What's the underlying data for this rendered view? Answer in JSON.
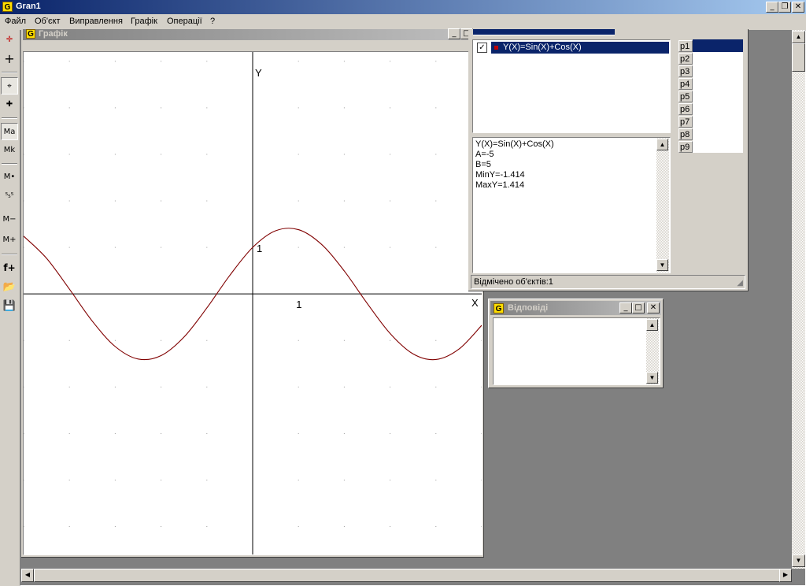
{
  "app": {
    "title": "Gran1",
    "icon": "G"
  },
  "menu": [
    "Файл",
    "Об'єкт",
    "Виправлення",
    "Графік",
    "Операції",
    "?"
  ],
  "toolbar": [
    {
      "name": "axes-icon",
      "glyph": "✛"
    },
    {
      "name": "crosshair-icon",
      "glyph": "+"
    },
    {
      "name": "point-icon",
      "glyph": "⌖"
    },
    {
      "name": "cross-icon",
      "glyph": "✚"
    },
    {
      "name": "zoom-auto-button",
      "glyph": "Ma"
    },
    {
      "name": "zoom-custom-button",
      "glyph": "Mk"
    },
    {
      "name": "zoom-point-button",
      "glyph": "M•"
    },
    {
      "name": "scale-button",
      "glyph": "⁵₅⁵"
    },
    {
      "name": "zoom-out-button",
      "glyph": "M−"
    },
    {
      "name": "zoom-in-button",
      "glyph": "M+"
    },
    {
      "name": "add-function-button",
      "glyph": "f+"
    },
    {
      "name": "open-folder-icon",
      "glyph": "📂"
    },
    {
      "name": "save-disk-icon",
      "glyph": "💾"
    }
  ],
  "graph_window": {
    "title": "Графік",
    "x_axis_label": "X",
    "y_axis_label": "Y",
    "x_tick_label": "1",
    "y_tick_label": "1"
  },
  "chart_data": {
    "type": "line",
    "title": "",
    "xlabel": "X",
    "ylabel": "Y",
    "xlim": [
      -5,
      5
    ],
    "ylim": [
      -5.6,
      5.2
    ],
    "grid": "dots",
    "series": [
      {
        "name": "Y(X)=Sin(X)+Cos(X)",
        "color": "#800000",
        "x": [
          -5,
          -4.5,
          -4,
          -3.5,
          -3,
          -2.5,
          -2,
          -1.5,
          -1,
          -0.5,
          0,
          0.5,
          1,
          1.5,
          2,
          2.5,
          3,
          3.5,
          4,
          4.5,
          5
        ],
        "y": [
          1.242,
          0.767,
          0.103,
          -0.586,
          -1.131,
          -1.399,
          -1.325,
          -0.927,
          -0.301,
          0.398,
          1.0,
          1.357,
          1.382,
          1.068,
          0.493,
          -0.203,
          -0.849,
          -1.287,
          -1.41,
          -1.188,
          -0.675
        ]
      }
    ]
  },
  "objects_panel": {
    "function_item": "Y(X)=Sin(X)+Cos(X)",
    "function_checked": true,
    "info_lines": [
      "Y(X)=Sin(X)+Cos(X)",
      "A=-5",
      "B=5",
      "MinY=-1.414",
      "MaxY=1.414"
    ],
    "status": "Відмічено об'єктів:1",
    "params": [
      "p1",
      "p2",
      "p3",
      "p4",
      "p5",
      "p6",
      "p7",
      "p8",
      "p9"
    ]
  },
  "answers_window": {
    "title": "Відповіді"
  },
  "colors": {
    "title_bar": "#0a246a",
    "title_bar_end": "#a6caf0",
    "selection": "#0a246a",
    "curve": "#800000",
    "mdi_background": "#808080"
  }
}
